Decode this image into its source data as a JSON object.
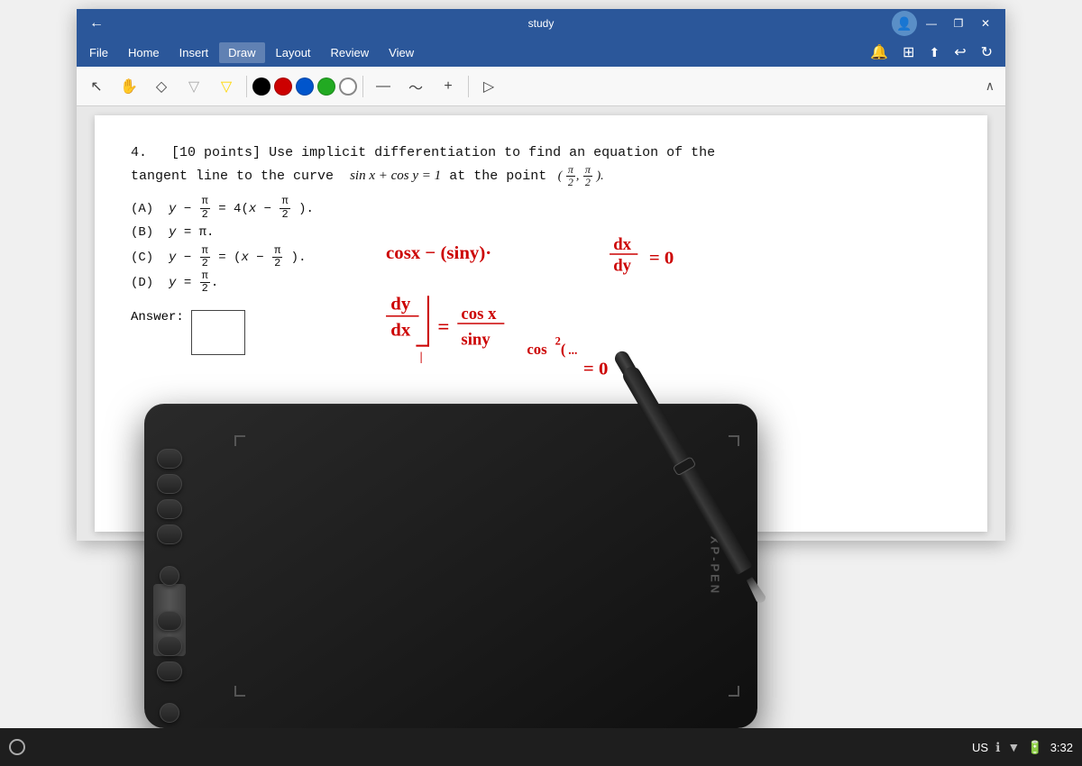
{
  "window": {
    "title": "study",
    "back_arrow": "←"
  },
  "titlebar": {
    "minimize": "—",
    "restore": "❐",
    "close": "✕",
    "user_icon": "👤"
  },
  "menubar": {
    "items": [
      "File",
      "Home",
      "Insert",
      "Draw",
      "Layout",
      "Review",
      "View"
    ],
    "active_item": "Draw",
    "icons": [
      "🔔",
      "⊞",
      "⬆",
      "↩",
      "↻"
    ]
  },
  "toolbar": {
    "tools": [
      {
        "name": "select",
        "icon": "↖"
      },
      {
        "name": "lasso",
        "icon": "✋"
      },
      {
        "name": "eraser",
        "icon": "◇"
      },
      {
        "name": "filter1",
        "icon": "▽"
      },
      {
        "name": "filter2",
        "icon": "▽"
      }
    ],
    "colors": [
      "#000000",
      "#cc0000",
      "#0055cc",
      "#22aa22",
      "#ffffff"
    ],
    "line_tools": [
      "—",
      "〜",
      "+"
    ],
    "extra": "▷",
    "collapse": "∧"
  },
  "document": {
    "problem": {
      "number": "4.",
      "points": "[10 points]",
      "instruction": "Use implicit differentiation to find an equation of the tangent line to the curve",
      "equation": "sin x + cos y = 1",
      "at_point": "at the point",
      "point": "(π/2, π/2)"
    },
    "choices": [
      {
        "label": "(A)",
        "math": "y − π/2 = 4(x − π/2)"
      },
      {
        "label": "(B)",
        "math": "y = π"
      },
      {
        "label": "(C)",
        "math": "y − π/2 = (x − π/2)"
      },
      {
        "label": "(D)",
        "math": "y = π/2"
      }
    ],
    "answer_label": "Answer:"
  },
  "handwriting": {
    "line1": "cosx − (siny)·",
    "dx_dy": "dx/dy",
    "equals_zero": "= 0",
    "line2": "dy/dx",
    "equals": "=",
    "fraction": "cos x / siny",
    "subscript": "= 0"
  },
  "tablet": {
    "brand": "XP-PEN"
  },
  "taskbar": {
    "lang": "US",
    "time": "3:32",
    "circle_icon": "○"
  }
}
